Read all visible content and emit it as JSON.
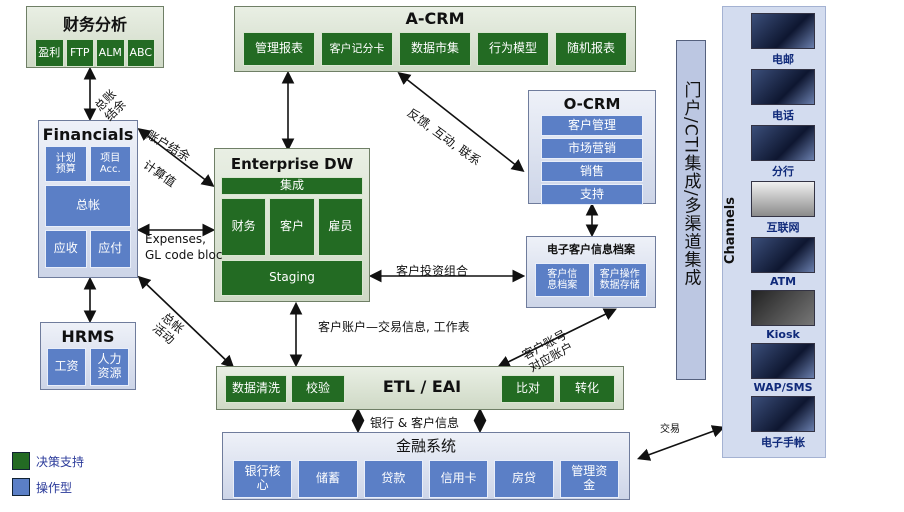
{
  "finance_analysis": {
    "title": "财务分析",
    "cells": [
      "盈利",
      "FTP",
      "ALM",
      "ABC"
    ]
  },
  "acrm": {
    "title": "A-CRM",
    "cells": [
      "管理报表",
      "客户记分卡",
      "数据市集",
      "行为模型",
      "随机报表"
    ]
  },
  "ocrm": {
    "title": "O-CRM",
    "cells": [
      "客户管理",
      "市场营销",
      "销售",
      "支持"
    ]
  },
  "financials": {
    "title": "Financials",
    "cells": [
      "计划\n预算",
      "项目\nAcc.",
      "总帐",
      "应收",
      "应付"
    ]
  },
  "edw": {
    "title": "Enterprise DW",
    "integration": "集成",
    "cells": [
      "财务",
      "客户",
      "雇员"
    ],
    "staging": "Staging"
  },
  "ecif": {
    "title": "电子客户信息档案",
    "cells": [
      "客户信\n息档案",
      "客户操作\n数据存储"
    ]
  },
  "hrms": {
    "title": "HRMS",
    "cells": [
      "工资",
      "人力\n资源"
    ]
  },
  "etl": {
    "title": "ETL / EAI",
    "left_cells": [
      "数据清洗",
      "校验"
    ],
    "right_cells": [
      "比对",
      "转化"
    ]
  },
  "core": {
    "title": "金融系统",
    "cells": [
      "银行核\n心",
      "储蓄",
      "贷款",
      "信用卡",
      "房贷",
      "管理资\n金"
    ]
  },
  "portal": {
    "text": "门户/CTI集成/多渠道集成"
  },
  "channels": {
    "title": "Channels",
    "items": [
      {
        "label": "电邮",
        "icon": "email-icon"
      },
      {
        "label": "电话",
        "icon": "phone-icon"
      },
      {
        "label": "分行",
        "icon": "branch-icon"
      },
      {
        "label": "互联网",
        "icon": "internet-icon"
      },
      {
        "label": "ATM",
        "icon": "atm-icon"
      },
      {
        "label": "Kiosk",
        "icon": "kiosk-icon"
      },
      {
        "label": "WAP/SMS",
        "icon": "wap-sms-icon"
      },
      {
        "label": "电子手帐",
        "icon": "pda-icon"
      }
    ]
  },
  "edge_labels": {
    "gl_settle": "总账\n结余",
    "account_settle": "账户结余",
    "calc_value": "计算值",
    "expenses": "Expenses,\nGL code bloc",
    "feedback": "反馈, 互动, 联系",
    "investment": "客户投资组合",
    "account_txn": "客户账户—交易信息, 工作表",
    "gl_activity": "总帐\n活动",
    "customer_account": "客户账号\n对应账户",
    "bank_customer": "银行 & 客户信息",
    "transaction": "交易"
  },
  "legend": [
    {
      "label": "决策支持",
      "color": "#236b23"
    },
    {
      "label": "操作型",
      "color": "#5b7fc6"
    }
  ],
  "colors": {
    "decision_support": "#236b23",
    "operational": "#5b7fc6",
    "portal": "#bcc7e2"
  }
}
